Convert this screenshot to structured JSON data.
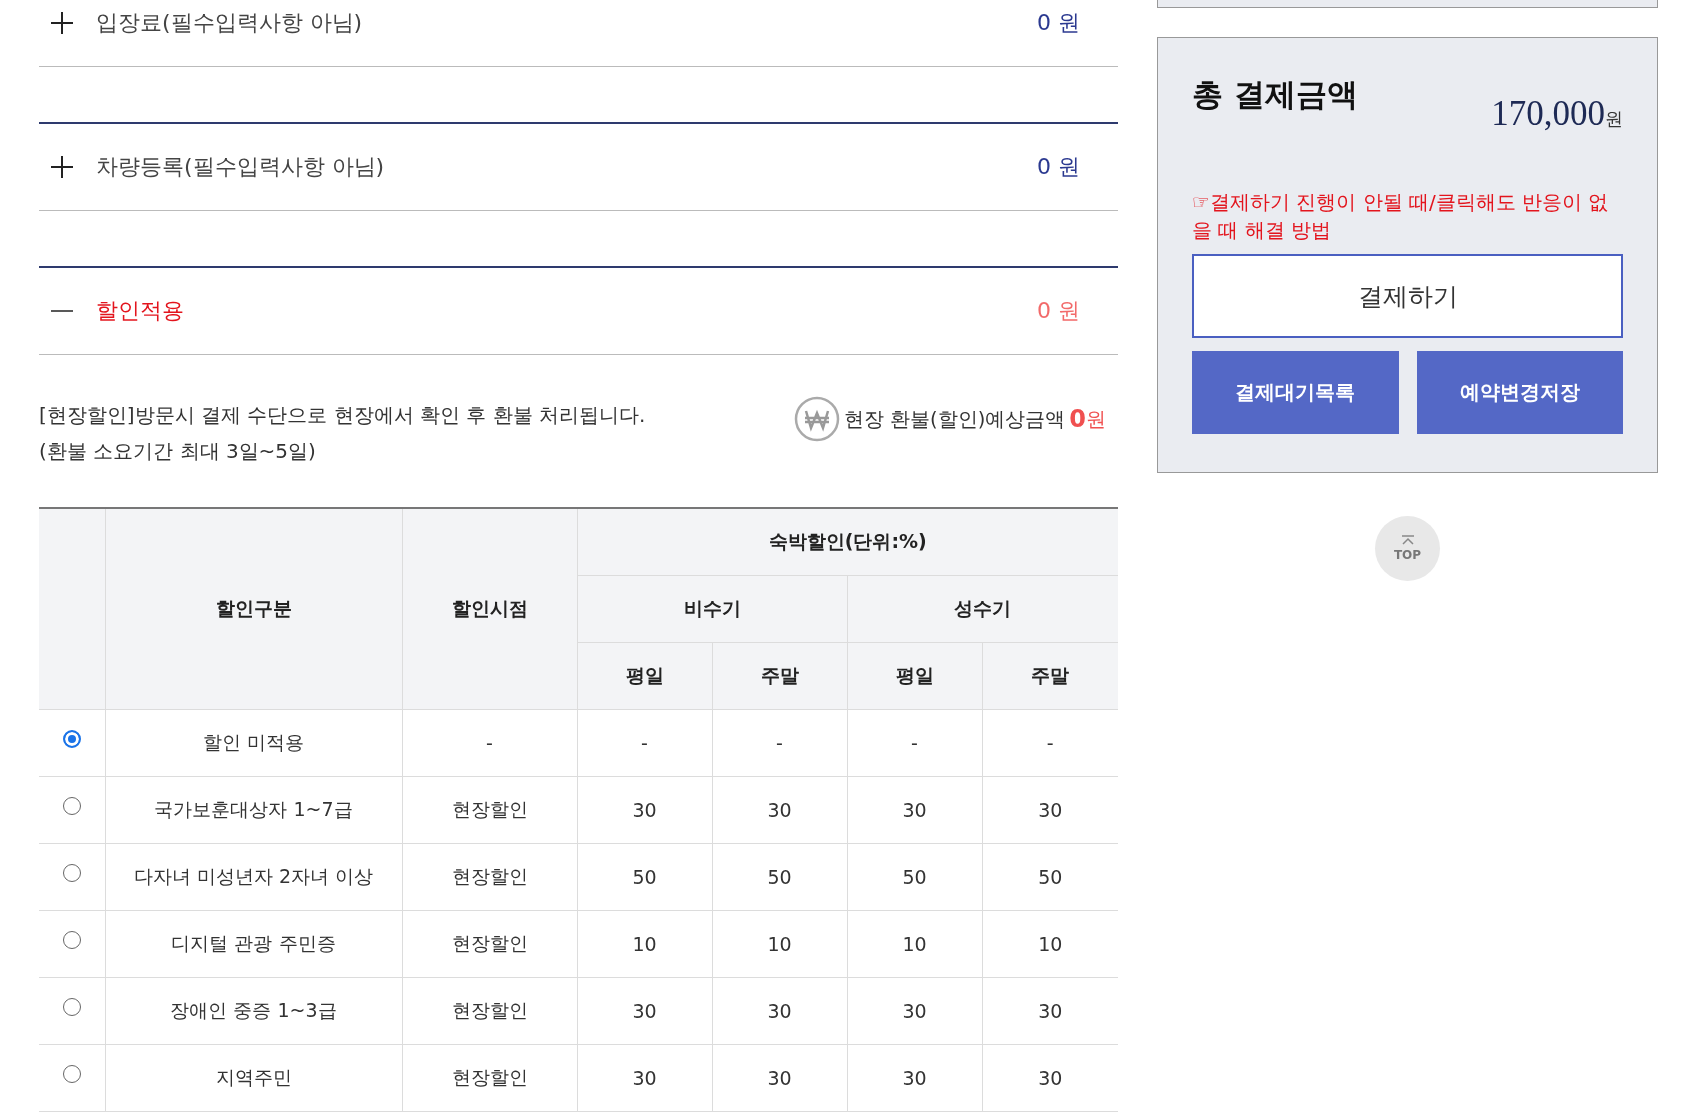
{
  "sections": [
    {
      "label": "입장료(필수입력사항 아님)",
      "amount": "0 원",
      "expanded": false
    },
    {
      "label": "차량등록(필수입력사항 아님)",
      "amount": "0 원",
      "expanded": false
    },
    {
      "label": "할인적용",
      "amount": "0 원",
      "expanded": true
    }
  ],
  "refund": {
    "notice": "[현장할인]방문시 결제 수단으로 현장에서 확인 후 환불 처리됩니다.",
    "period": "(환불 소요기간 최대 3일~5일)",
    "estimate_label": "현장 환불(할인)예상금액",
    "estimate_value": "0",
    "estimate_unit": "원"
  },
  "discount_table": {
    "columns": {
      "category": "할인구분",
      "timing": "할인시점",
      "group": "숙박할인(단위:%)",
      "seasons": [
        {
          "label": "비수기",
          "days": [
            "평일",
            "주말"
          ]
        },
        {
          "label": "성수기",
          "days": [
            "평일",
            "주말"
          ]
        }
      ]
    },
    "rows": [
      {
        "selected": true,
        "category": "할인 미적용",
        "timing": "-",
        "rates": [
          "-",
          "-",
          "-",
          "-"
        ]
      },
      {
        "selected": false,
        "category": "국가보훈대상자 1~7급",
        "timing": "현장할인",
        "rates": [
          "30",
          "30",
          "30",
          "30"
        ]
      },
      {
        "selected": false,
        "category": "다자녀 미성년자 2자녀 이상",
        "timing": "현장할인",
        "rates": [
          "50",
          "50",
          "50",
          "50"
        ]
      },
      {
        "selected": false,
        "category": "디지털 관광 주민증",
        "timing": "현장할인",
        "rates": [
          "10",
          "10",
          "10",
          "10"
        ]
      },
      {
        "selected": false,
        "category": "장애인 중증 1~3급",
        "timing": "현장할인",
        "rates": [
          "30",
          "30",
          "30",
          "30"
        ]
      },
      {
        "selected": false,
        "category": "지역주민",
        "timing": "현장할인",
        "rates": [
          "30",
          "30",
          "30",
          "30"
        ]
      }
    ]
  },
  "payment": {
    "title": "총 결제금액",
    "amount": "170,000",
    "unit": "원",
    "help_link": "☞결제하기 진행이 안될 때/클릭해도 반응이 없을 때 해결 방법",
    "pay_button": "결제하기",
    "buttons": [
      "결제대기목록",
      "예약변경저장"
    ]
  },
  "top_button": "TOP"
}
